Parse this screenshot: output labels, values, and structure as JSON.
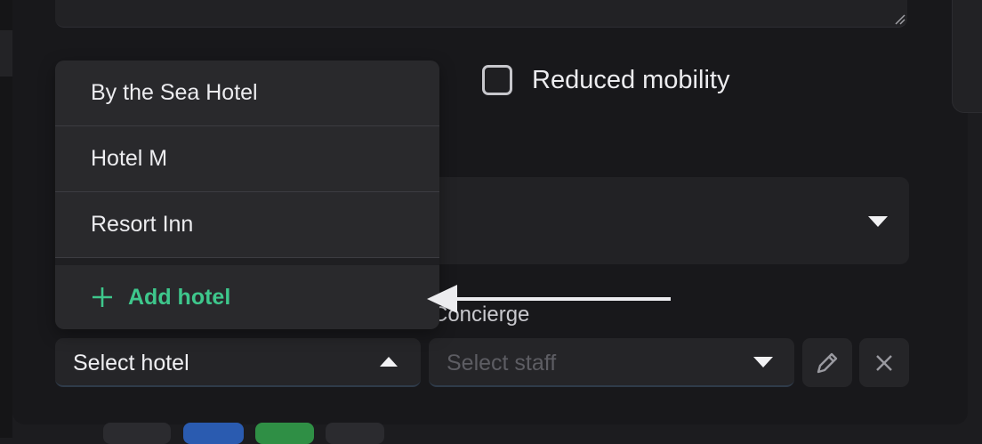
{
  "checkbox": {
    "label": "Reduced mobility",
    "checked": false
  },
  "hotel_dropdown": {
    "options": [
      "By the Sea Hotel",
      "Hotel M",
      "Resort Inn"
    ],
    "add_label": "Add hotel",
    "add_color": "#3ec78c"
  },
  "hotel_select": {
    "value": "Select hotel",
    "icon": "caret-up-icon"
  },
  "concierge": {
    "label": "Concierge"
  },
  "staff_select": {
    "placeholder": "Select staff",
    "icon": "caret-down-icon"
  },
  "actions": {
    "edit_icon": "pencil-icon",
    "clear_icon": "close-icon"
  },
  "colors": {
    "background": "#18181b",
    "surface": "#222225",
    "accent": "#3ec78c"
  }
}
